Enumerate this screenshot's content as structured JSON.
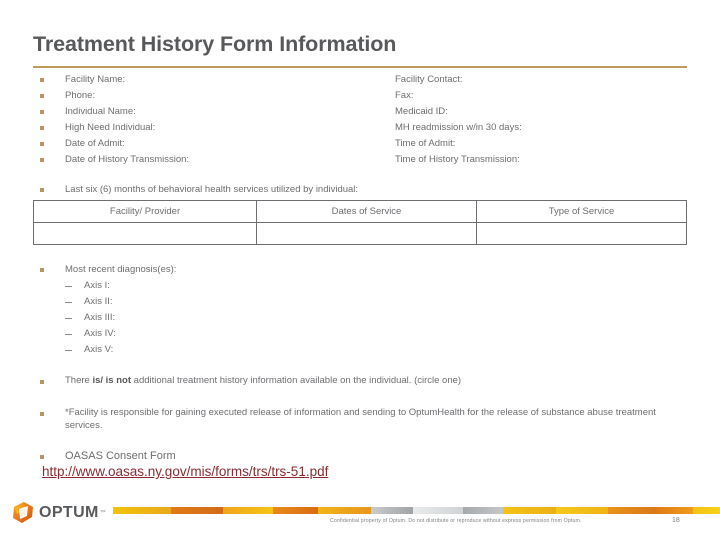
{
  "slide": {
    "title": "Treatment History Form Information",
    "accent_rule_color": "#c19a5b",
    "bullet_color": "#b89464",
    "text_color": "#6d6e71",
    "link_color": "#8c2b30"
  },
  "form_fields": [
    {
      "left": "Facility Name:",
      "right": "Facility Contact:"
    },
    {
      "left": "Phone:",
      "right": "Fax:"
    },
    {
      "left": "Individual Name:",
      "right": "Medicaid ID:"
    },
    {
      "left": "High Need Individual:",
      "right": "MH readmission w/in 30 days:"
    },
    {
      "left": "Date of Admit:",
      "right": "Time of Admit:"
    },
    {
      "left": "Date of History Transmission:",
      "right": "Time of History Transmission:"
    }
  ],
  "services": {
    "heading": "Last six (6) months of behavioral health services utilized by individual:",
    "columns": [
      "Facility/ Provider",
      "Dates of Service",
      "Type of Service"
    ],
    "rows": [
      [
        "",
        "",
        ""
      ]
    ]
  },
  "diagnoses": {
    "heading": "Most recent diagnosis(es):",
    "items": [
      "Axis I:",
      "Axis II:",
      "Axis III:",
      "Axis IV:",
      "Axis V:"
    ]
  },
  "statements": {
    "circle_one": {
      "prefix": "There ",
      "bold": "is/ is not",
      "suffix": " additional treatment history information available on the individual.  (circle one)"
    },
    "facility_note": "*Facility is responsible for gaining executed release of information and sending to OptumHealth for the release of substance abuse treatment services."
  },
  "oasas": {
    "label": "OASAS Consent Form",
    "url": "http://www.oasas.ny.gov/mis/forms/trs/trs-51.pdf"
  },
  "footer": {
    "logo_text": "OPTUM",
    "logo_tm": "™",
    "note": "Confidential property of Optum. Do not distribute or reproduce without express permission from Optum.",
    "page_number": "18"
  }
}
